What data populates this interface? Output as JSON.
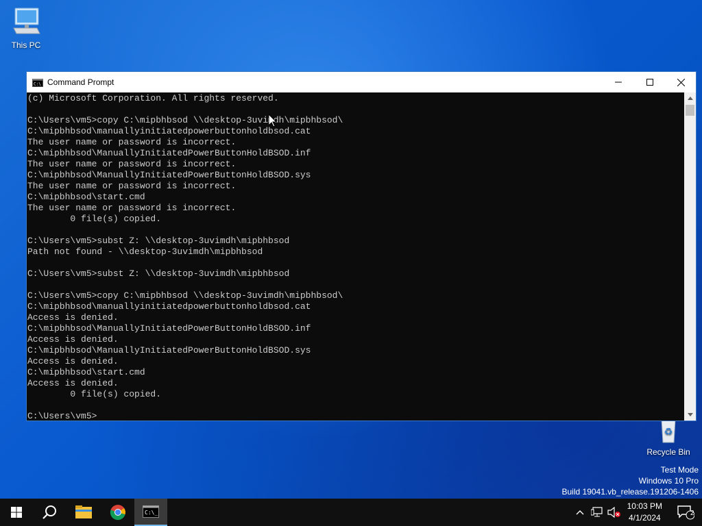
{
  "desktop": {
    "icons": [
      {
        "label": "This PC"
      },
      {
        "label": "Recycle Bin"
      }
    ],
    "watermark": {
      "line1": "Test Mode",
      "line2": "Windows 10 Pro",
      "line3": "Build 19041.vb_release.191206-1406"
    }
  },
  "window": {
    "title": "Command Prompt",
    "controls": {
      "minimize": "minimize",
      "maximize": "maximize",
      "close": "close"
    },
    "console_lines": [
      "(c) Microsoft Corporation. All rights reserved.",
      "",
      "C:\\Users\\vm5>copy C:\\mipbhbsod \\\\desktop-3uvimdh\\mipbhbsod\\",
      "C:\\mipbhbsod\\manuallyinitiatedpowerbuttonholdbsod.cat",
      "The user name or password is incorrect.",
      "C:\\mipbhbsod\\ManuallyInitiatedPowerButtonHoldBSOD.inf",
      "The user name or password is incorrect.",
      "C:\\mipbhbsod\\ManuallyInitiatedPowerButtonHoldBSOD.sys",
      "The user name or password is incorrect.",
      "C:\\mipbhbsod\\start.cmd",
      "The user name or password is incorrect.",
      "        0 file(s) copied.",
      "",
      "C:\\Users\\vm5>subst Z: \\\\desktop-3uvimdh\\mipbhbsod",
      "Path not found - \\\\desktop-3uvimdh\\mipbhbsod",
      "",
      "C:\\Users\\vm5>subst Z: \\\\desktop-3uvimdh\\mipbhbsod",
      "",
      "C:\\Users\\vm5>copy C:\\mipbhbsod \\\\desktop-3uvimdh\\mipbhbsod\\",
      "C:\\mipbhbsod\\manuallyinitiatedpowerbuttonholdbsod.cat",
      "Access is denied.",
      "C:\\mipbhbsod\\ManuallyInitiatedPowerButtonHoldBSOD.inf",
      "Access is denied.",
      "C:\\mipbhbsod\\ManuallyInitiatedPowerButtonHoldBSOD.sys",
      "Access is denied.",
      "C:\\mipbhbsod\\start.cmd",
      "Access is denied.",
      "        0 file(s) copied.",
      "",
      "C:\\Users\\vm5>"
    ]
  },
  "taskbar": {
    "apps": [
      {
        "name": "start"
      },
      {
        "name": "search"
      },
      {
        "name": "file-explorer"
      },
      {
        "name": "chrome"
      },
      {
        "name": "command-prompt"
      }
    ],
    "clock": {
      "time": "10:03 PM",
      "date": "4/1/2024"
    },
    "notification_count": "2"
  }
}
